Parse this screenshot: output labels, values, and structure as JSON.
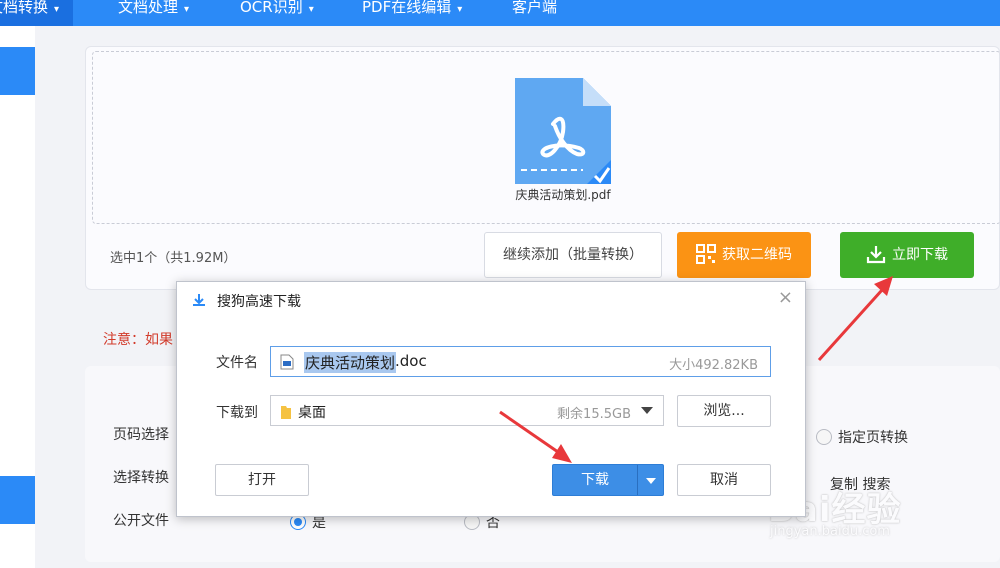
{
  "nav": {
    "items": [
      "文档转换",
      "文档处理",
      "OCR识别",
      "PDF在线编辑",
      "客户端"
    ]
  },
  "upload": {
    "file_name": "庆典活动策划.pdf",
    "select_info": "选中1个（共1.92M）",
    "continue_label": "继续添加（批量转换）",
    "qr_label": "获取二维码",
    "download_label": "立即下载",
    "colors": {
      "qr": "#fb9314",
      "download": "#3fae29",
      "file_icon": "#5fa8f2"
    }
  },
  "notice": "注意：如果",
  "settings": {
    "page_label": "页码选择",
    "convert_label": "选择转换",
    "public_label": "公开文件",
    "specified_pages": "指定页转换",
    "yes": "是",
    "no": "否",
    "copy": "复制",
    "search": "搜索"
  },
  "dialog": {
    "title": "搜狗高速下载",
    "filename_label": "文件名",
    "filename_selected": "庆典活动策划",
    "filename_ext": ".doc",
    "size": "大小492.82KB",
    "dest_label": "下载到",
    "dest": "桌面",
    "free_space": "剩余15.5GB",
    "browse": "浏览...",
    "open": "打开",
    "download": "下载",
    "cancel": "取消"
  },
  "watermark": {
    "brand": "Bai经验",
    "url": "jingyan.baidu.com"
  }
}
